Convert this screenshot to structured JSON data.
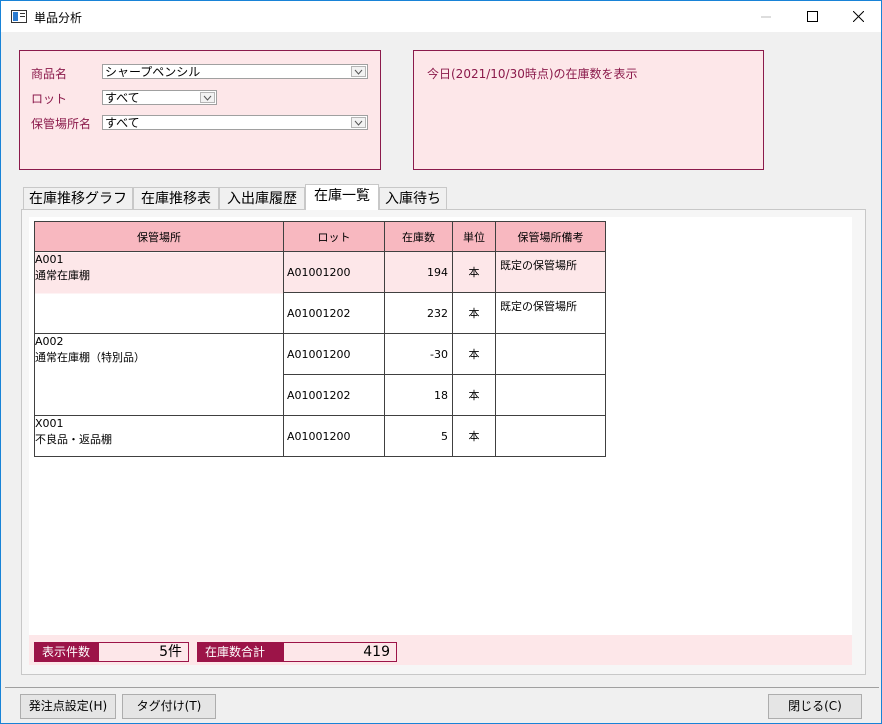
{
  "window": {
    "title": "単品分析"
  },
  "filters": {
    "product_label": "商品名",
    "product_value": "シャープペンシル",
    "lot_label": "ロット",
    "lot_value": "すべて",
    "location_label": "保管場所名",
    "location_value": "すべて"
  },
  "info_panel": {
    "text": "今日(2021/10/30時点)の在庫数を表示"
  },
  "tabs": [
    {
      "label": "在庫推移グラフ",
      "active": false
    },
    {
      "label": "在庫推移表",
      "active": false
    },
    {
      "label": "入出庫履歴",
      "active": false
    },
    {
      "label": "在庫一覧",
      "active": true
    },
    {
      "label": "入庫待ち",
      "active": false
    }
  ],
  "grid": {
    "columns": [
      "保管場所",
      "ロット",
      "在庫数",
      "単位",
      "保管場所備考"
    ],
    "locations": [
      {
        "code": "A001",
        "name": "通常在庫棚"
      },
      {
        "code": "A002",
        "name": "通常在庫棚（特別品）"
      },
      {
        "code": "X001",
        "name": "不良品・返品棚"
      }
    ],
    "rows": [
      {
        "lot": "A01001200",
        "qty": "194",
        "unit": "本",
        "note": "既定の保管場所"
      },
      {
        "lot": "A01001202",
        "qty": "232",
        "unit": "本",
        "note": "既定の保管場所"
      },
      {
        "lot": "A01001200",
        "qty": "-30",
        "unit": "本",
        "note": ""
      },
      {
        "lot": "A01001202",
        "qty": "18",
        "unit": "本",
        "note": ""
      },
      {
        "lot": "A01001200",
        "qty": "5",
        "unit": "本",
        "note": ""
      }
    ]
  },
  "summary": {
    "count_label": "表示件数",
    "count_value": "5件",
    "total_label": "在庫数合計",
    "total_value": "419"
  },
  "buttons": {
    "reorder": "発注点設定(H)",
    "tag": "タグ付け(T)",
    "close": "閉じる(C)"
  },
  "icons": {
    "app": "app-window-icon",
    "minimize": "minimize-icon",
    "maximize": "maximize-icon",
    "close": "close-icon",
    "dropdown": "chevron-down-icon"
  },
  "colors": {
    "accent": "#8b1a4b",
    "panel_bg": "#fde7e9",
    "header_bg": "#f8b8c0",
    "summary_label_bg": "#9c1448"
  }
}
